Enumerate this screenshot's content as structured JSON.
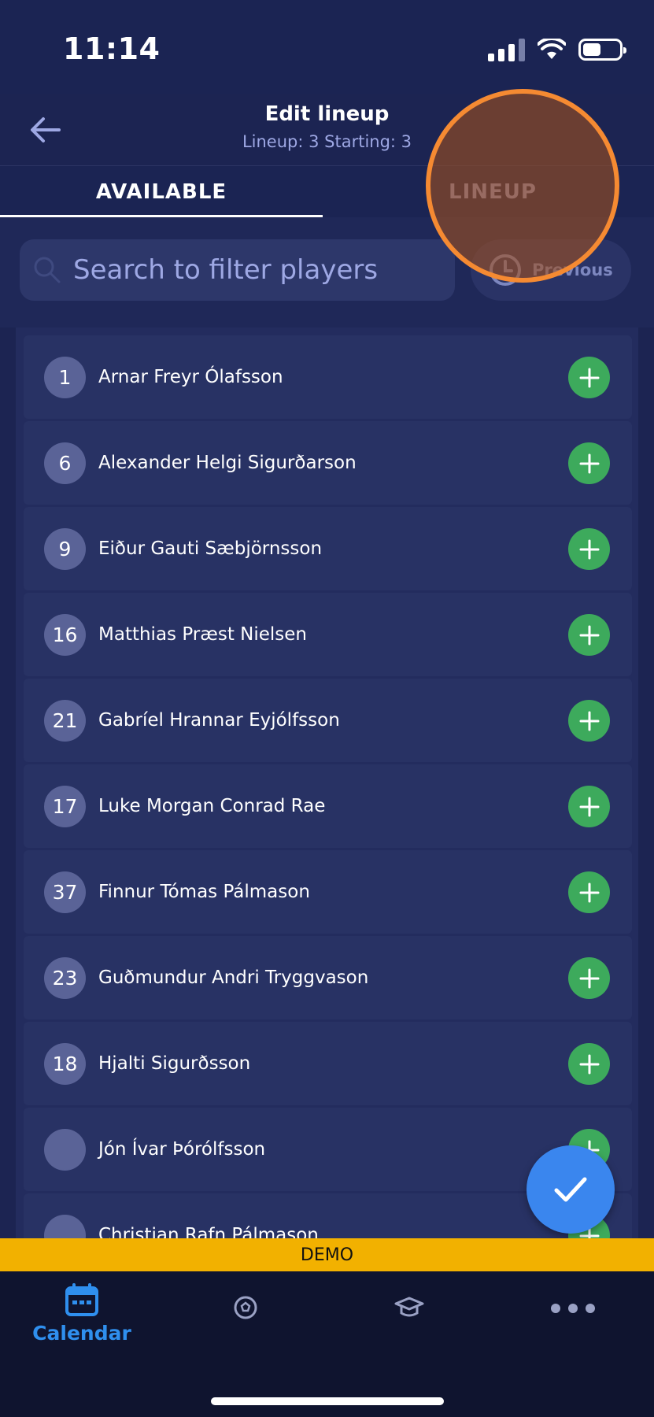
{
  "status_bar": {
    "time": "11:14"
  },
  "header": {
    "title": "Edit lineup",
    "subtitle": "Lineup: 3 Starting: 3"
  },
  "tabs": [
    {
      "label": "AVAILABLE",
      "active": true
    },
    {
      "label": "LINEUP",
      "active": false
    }
  ],
  "search": {
    "placeholder": "Search to filter players",
    "value": ""
  },
  "previous_button": {
    "label": "Previous",
    "icon": "clock-icon"
  },
  "players": [
    {
      "number": "1",
      "name": "Arnar Freyr Ólafsson"
    },
    {
      "number": "6",
      "name": "Alexander Helgi Sigurðarson"
    },
    {
      "number": "9",
      "name": "Eiður Gauti Sæbjörnsson"
    },
    {
      "number": "16",
      "name": "Matthias Præst Nielsen"
    },
    {
      "number": "21",
      "name": "Gabríel Hrannar Eyjólfsson"
    },
    {
      "number": "17",
      "name": "Luke Morgan Conrad Rae"
    },
    {
      "number": "37",
      "name": "Finnur Tómas Pálmason"
    },
    {
      "number": "23",
      "name": "Guðmundur Andri Tryggvason"
    },
    {
      "number": "18",
      "name": "Hjalti Sigurðsson"
    },
    {
      "number": "",
      "name": "Jón Ívar Þórólfsson"
    },
    {
      "number": "",
      "name": "Christian Rafn Pálmason"
    }
  ],
  "banner": "DEMO",
  "bottom_nav": [
    {
      "label": "Calendar",
      "icon": "calendar-icon",
      "active": true
    },
    {
      "label": "",
      "icon": "football-icon",
      "active": false
    },
    {
      "label": "",
      "icon": "graduation-cap-icon",
      "active": false
    },
    {
      "label": "",
      "icon": "more-icon",
      "active": false
    }
  ],
  "colors": {
    "background": "#1c2452",
    "add_button": "#3daa5c",
    "fab": "#3a86ee",
    "banner": "#f2b100",
    "nav_active": "#2f8fee",
    "highlight_ring": "#f58a32"
  }
}
